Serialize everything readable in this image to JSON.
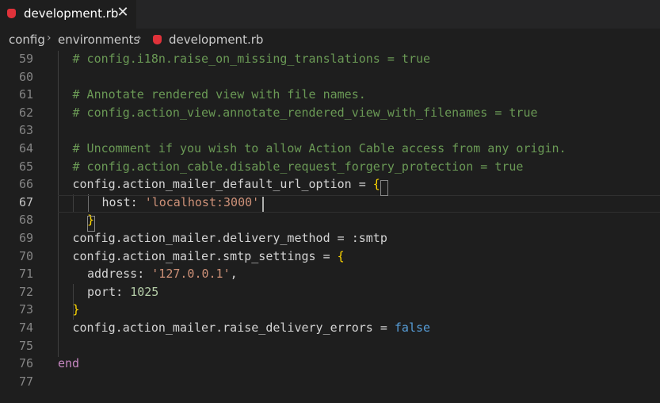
{
  "tab": {
    "file_name": "development.rb",
    "close_glyph": "✕",
    "icon": "ruby-icon",
    "icon_color": "#e0323a"
  },
  "breadcrumb": {
    "items": [
      "config",
      "environments",
      "development.rb"
    ],
    "separator": "›"
  },
  "editor": {
    "active_line": 67,
    "lines": [
      {
        "n": "59",
        "tokens": [
          {
            "t": "# config.i18n.raise_on_missing_translations = true",
            "c": "cmt"
          }
        ]
      },
      {
        "n": "60",
        "tokens": []
      },
      {
        "n": "61",
        "tokens": [
          {
            "t": "# Annotate rendered view with file names.",
            "c": "cmt"
          }
        ]
      },
      {
        "n": "62",
        "tokens": [
          {
            "t": "# config.action_view.annotate_rendered_view_with_filenames = true",
            "c": "cmt"
          }
        ]
      },
      {
        "n": "63",
        "tokens": []
      },
      {
        "n": "64",
        "tokens": [
          {
            "t": "# Uncomment if you wish to allow Action Cable access from any origin.",
            "c": "cmt"
          }
        ]
      },
      {
        "n": "65",
        "tokens": [
          {
            "t": "# config.action_cable.disable_request_forgery_protection = true",
            "c": "cmt"
          }
        ]
      },
      {
        "n": "66",
        "tokens": [
          {
            "t": "config.action_mailer_default_url_option = ",
            "c": "plain"
          },
          {
            "t": "{",
            "c": "brace"
          }
        ]
      },
      {
        "n": "67",
        "tokens": [
          {
            "t": "host: ",
            "c": "plain"
          },
          {
            "t": "'localhost:3000'",
            "c": "str"
          }
        ]
      },
      {
        "n": "68",
        "tokens": [
          {
            "t": "}",
            "c": "brace"
          }
        ]
      },
      {
        "n": "69",
        "tokens": [
          {
            "t": "config.action_mailer.delivery_method = :smtp",
            "c": "plain"
          }
        ]
      },
      {
        "n": "70",
        "tokens": [
          {
            "t": "config.action_mailer.smtp_settings = ",
            "c": "plain"
          },
          {
            "t": "{",
            "c": "brace"
          }
        ]
      },
      {
        "n": "71",
        "tokens": [
          {
            "t": "address: ",
            "c": "plain"
          },
          {
            "t": "'127.0.0.1'",
            "c": "str"
          },
          {
            "t": ",",
            "c": "plain"
          }
        ]
      },
      {
        "n": "72",
        "tokens": [
          {
            "t": "port: ",
            "c": "plain"
          },
          {
            "t": "1025",
            "c": "num"
          }
        ]
      },
      {
        "n": "73",
        "tokens": [
          {
            "t": "}",
            "c": "brace"
          }
        ]
      },
      {
        "n": "74",
        "tokens": [
          {
            "t": "config.action_mailer.raise_delivery_errors = ",
            "c": "plain"
          },
          {
            "t": "false",
            "c": "bool"
          }
        ]
      },
      {
        "n": "75",
        "tokens": []
      },
      {
        "n": "76",
        "tokens": [
          {
            "t": "end",
            "c": "kw"
          }
        ]
      },
      {
        "n": "77",
        "tokens": []
      }
    ]
  },
  "colors": {
    "background": "#1e1e1e",
    "comment": "#6a9955",
    "string": "#ce9178",
    "number": "#b5cea8",
    "keyword": "#c586c0",
    "boolean": "#569cd6",
    "brace": "#ffd700"
  }
}
